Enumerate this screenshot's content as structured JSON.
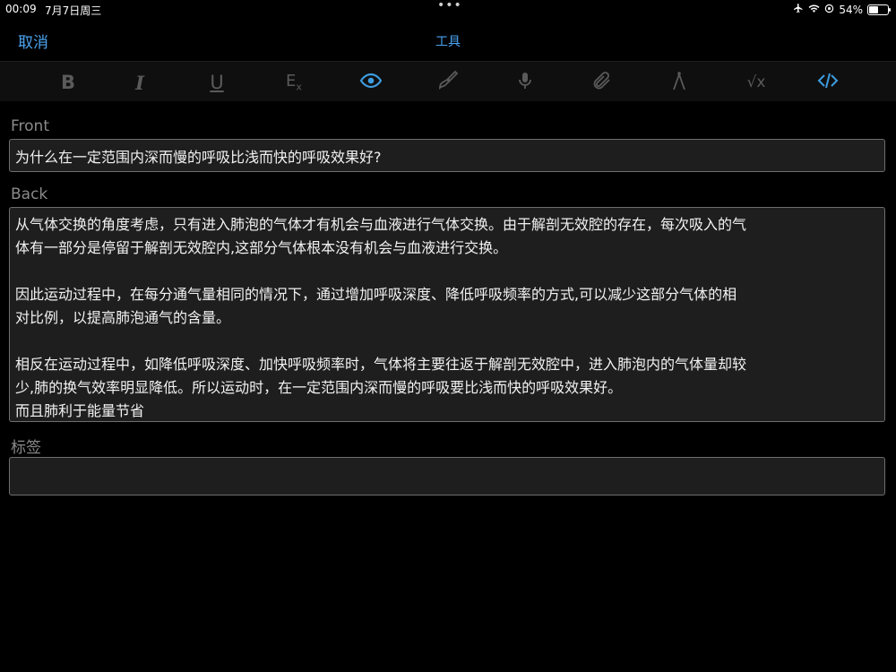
{
  "status": {
    "time": "00:09",
    "date": "7月7日周三",
    "dots": "•••",
    "icons": [
      "airplane-icon",
      "wifi-icon",
      "orientation-lock-icon"
    ],
    "battery_text": "54%",
    "battery_level": 0.54
  },
  "nav": {
    "cancel": "取消",
    "title": "工具"
  },
  "toolbar": {
    "bold": "B",
    "italic": "I",
    "underline": "U",
    "clear": "E",
    "clear_sub": "x",
    "sqrt": "√x"
  },
  "front": {
    "label": "Front",
    "value": "为什么在一定范围内深而慢的呼吸比浅而快的呼吸效果好?"
  },
  "back": {
    "label": "Back",
    "lines": [
      "从气体交换的角度考虑，只有进入肺泡的气体才有机会与血液进行气体交换。由于解剖无效腔的存在，每次吸入的气",
      "体有一部分是停留于解剖无效腔内,这部分气体根本没有机会与血液进行交换。",
      "因此运动过程中，在每分通气量相同的情况下，通过增加呼吸深度、降低呼吸频率的方式,可以减少这部分气体的相",
      "对比例，以提高肺泡通气的含量。",
      "相反在运动过程中，如降低呼吸深度、加快呼吸频率时，气体将主要往返于解剖无效腔中，进入肺泡内的气体量却较",
      "少,肺的换气效率明显降低。所以运动时，在一定范围内深而慢的呼吸要比浅而快的呼吸效果好。",
      "而且肺利于能量节省"
    ]
  },
  "tags": {
    "label": "标签",
    "value": ""
  }
}
